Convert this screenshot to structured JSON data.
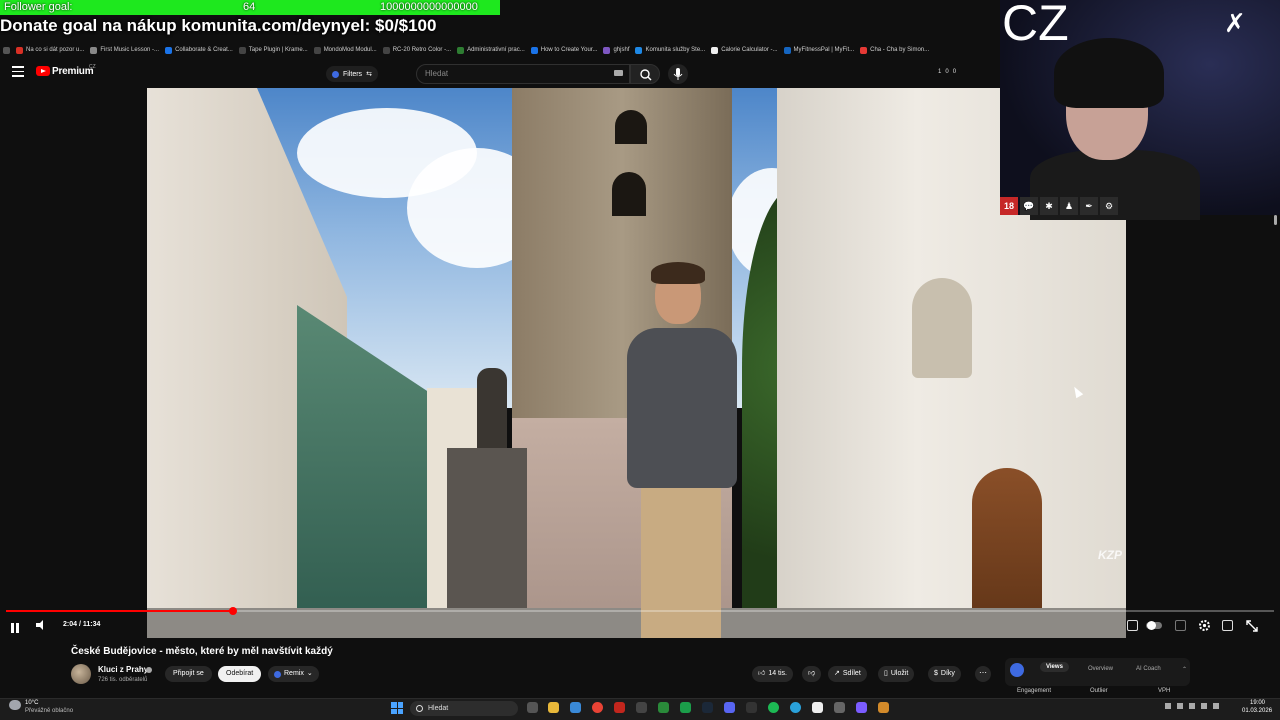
{
  "overlay": {
    "goal_label": "Follower goal:",
    "goal_current": "64",
    "goal_target": "1000000000000000",
    "donate_text": "Donate goal na nákup komunita.com/deynyel: $0/$100",
    "cam_text": "CZ"
  },
  "bookmarks": [
    {
      "label": "Na co si dát pozor u...",
      "color": "#d93025"
    },
    {
      "label": "First Music Lesson -...",
      "color": "#888888"
    },
    {
      "label": "Collaborate & Creat...",
      "color": "#1a73e8"
    },
    {
      "label": "Tape Plugin | Krame...",
      "color": "#444444"
    },
    {
      "label": "MondoMod Modul...",
      "color": "#444444"
    },
    {
      "label": "RC-20 Retro Color -...",
      "color": "#444444"
    },
    {
      "label": "Administrativní prac...",
      "color": "#2e7d32"
    },
    {
      "label": "How to Create Your...",
      "color": "#1a73e8"
    },
    {
      "label": "ghjshf",
      "color": "#7e57c2"
    },
    {
      "label": "Komunita služby Ste...",
      "color": "#1e88e5"
    },
    {
      "label": "Calorie Calculator -...",
      "color": "#eeeeee"
    },
    {
      "label": "MyFitnessPal | MyFit...",
      "color": "#1565c0"
    },
    {
      "label": "Cha - Cha by Simon...",
      "color": "#e53935"
    }
  ],
  "youtube": {
    "brand": "Premium",
    "region": "CZ",
    "filters_label": "Filters",
    "search_placeholder": "Hledat",
    "counter_a": "1",
    "counter_b": "0",
    "counter_c": "0"
  },
  "player": {
    "time_display": "2:04 / 11:34",
    "progress": 0.179,
    "watermark": "KZP"
  },
  "video": {
    "title": "České Budějovice - město, které by měl navštívit každý",
    "channel": "Kluci z Prahy",
    "subscribers": "726 tis. odběratelů",
    "join_label": "Připojit se",
    "subscribe_label": "Odebírat",
    "remix_label": "Remix",
    "likes_label": "14 tis.",
    "share_label": "Sdílet",
    "save_label": "Uložit",
    "thanks_label": "Díky"
  },
  "analytics_panel": {
    "tab_views": "Views",
    "tab_overview": "Overview",
    "tab_coach": "AI Coach",
    "label_engagement": "Engagement",
    "label_outlier": "Outlier",
    "label_vph": "VPH"
  },
  "taskbar": {
    "weather_temp": "10°C",
    "weather_desc": "Převážně oblačno",
    "search_label": "Hledat",
    "time": "19:00",
    "date": "01.03.2026"
  },
  "cam_icons": [
    "18",
    "💬",
    "✱",
    "♟",
    "✒",
    "⚙"
  ]
}
